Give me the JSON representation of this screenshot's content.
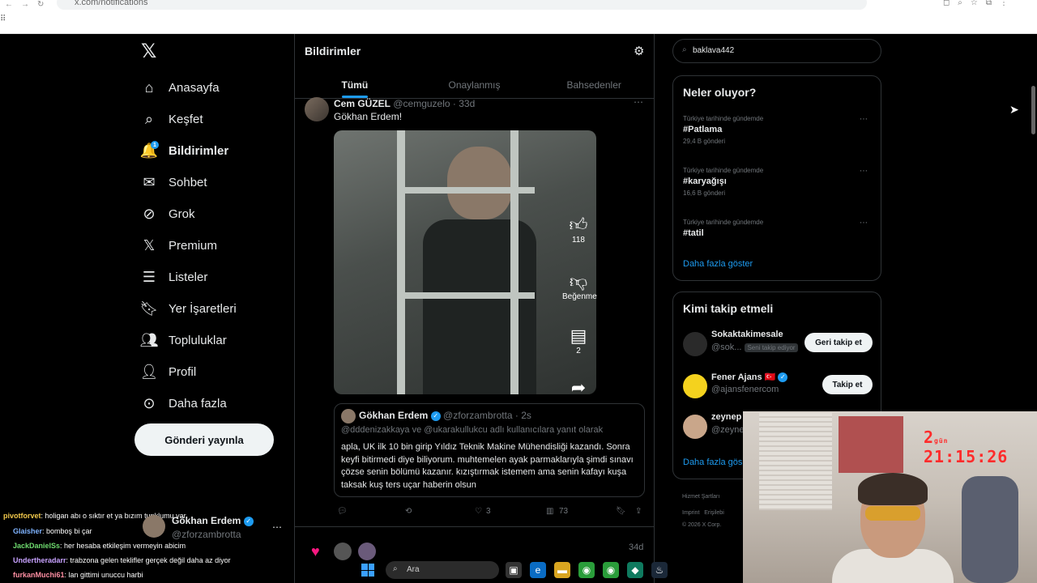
{
  "browser": {
    "url": "x.com/notifications"
  },
  "sidebar": {
    "items": [
      {
        "label": "Anasayfa",
        "icon": "home-icon"
      },
      {
        "label": "Keşfet",
        "icon": "search-icon"
      },
      {
        "label": "Bildirimler",
        "icon": "bell-icon",
        "badge": "1"
      },
      {
        "label": "Sohbet",
        "icon": "mail-icon"
      },
      {
        "label": "Grok",
        "icon": "grok-icon"
      },
      {
        "label": "Premium",
        "icon": "x-logo-icon"
      },
      {
        "label": "Listeler",
        "icon": "list-icon"
      },
      {
        "label": "Yer İşaretleri",
        "icon": "bookmark-icon"
      },
      {
        "label": "Topluluklar",
        "icon": "people-icon"
      },
      {
        "label": "Profil",
        "icon": "user-icon"
      },
      {
        "label": "Daha fazla",
        "icon": "more-circle-icon"
      }
    ],
    "post_button": "Gönderi yayınla"
  },
  "center": {
    "title": "Bildirimler",
    "tabs": [
      "Tümü",
      "Onaylanmış",
      "Bahsedenler"
    ],
    "tweet": {
      "name": "Cem GÜZEL",
      "handle": "@cemguzelo · 33d",
      "text": "Gökhan Erdem!",
      "video_actions": {
        "likes": "118",
        "dislike_label": "Beğenme",
        "comments": "2"
      },
      "quote": {
        "name": "Gökhan Erdem",
        "handle": "@zforzambrotta · 2s",
        "reply_to": "@dddenizakkaya ve @ukarakullukcu adlı kullanıcılara yanıt olarak",
        "body": "apla, UK ilk 10 bin girip Yıldız Teknik Makine Mühendisliği kazandı. Sonra keyfi bitirmedi diye biliyorum. muhtemelen ayak parmaklarıyla şimdi sınavı çözse senin bölümü kazanır. kızıştırmak istemem ama senin kafayı kuşa taksak kuş ters uçar haberin olsun"
      },
      "actions": {
        "retweets": "",
        "likes": "3",
        "views": "73"
      }
    },
    "notif2_age": "34d"
  },
  "right": {
    "search_value": "baklava442",
    "trends_title": "Neler oluyor?",
    "trends": [
      {
        "context": "Türkiye tarihinde gündemde",
        "tag": "#Patlama",
        "count": "29,4 B gönderi"
      },
      {
        "context": "Türkiye tarihinde gündemde",
        "tag": "#karyağışı",
        "count": "16,6 B gönderi"
      },
      {
        "context": "Türkiye tarihinde gündemde",
        "tag": "#tatil",
        "count": ""
      }
    ],
    "show_more": "Daha fazla göster",
    "follow_title": "Kimi takip etmeli",
    "follow": [
      {
        "name": "Sokaktakimesale",
        "handle": "@sok...",
        "badge": "Seni takip ediyor",
        "button": "Geri takip et"
      },
      {
        "name": "Fener Ajans 🇹🇷",
        "handle": "@ajansfenercom",
        "badge": "",
        "button": "Takip et"
      },
      {
        "name": "zeynep",
        "handle": "@zeyne",
        "badge": "",
        "button": ""
      }
    ],
    "follow_more": "Daha fazla gös",
    "footer": [
      "Hizmet Şartları",
      "Imprint",
      "Erişilebi",
      "© 2026 X Corp."
    ]
  },
  "overlay": {
    "timer": "2",
    "timer_small": "gün",
    "timer_clock": "21:15:26",
    "chat": [
      {
        "user": "pivotforvet",
        "color": "#f2c94c",
        "msg": ": holigan abı o sıktır et ya bızım tunklumu var"
      },
      {
        "user": "Glaisher",
        "color": "#7fb3ff",
        "msg": ": bomboş bi çar"
      },
      {
        "user": "JackDanielSs",
        "color": "#6fdc6f",
        "msg": ": her hesaba etkileşim vermeyin abicim"
      },
      {
        "user": "Undertheradarr",
        "color": "#c8a2ff",
        "msg": ": trabzona gelen teklifler gerçek değil daha az diyor"
      },
      {
        "user": "furkanMuchi61",
        "color": "#ff8fa3",
        "msg": ": lan gittimi unuccu harbi"
      }
    ],
    "popup_name": "Gökhan Erdem",
    "popup_handle": "@zforzambrotta",
    "taskbar_search": "Ara"
  }
}
